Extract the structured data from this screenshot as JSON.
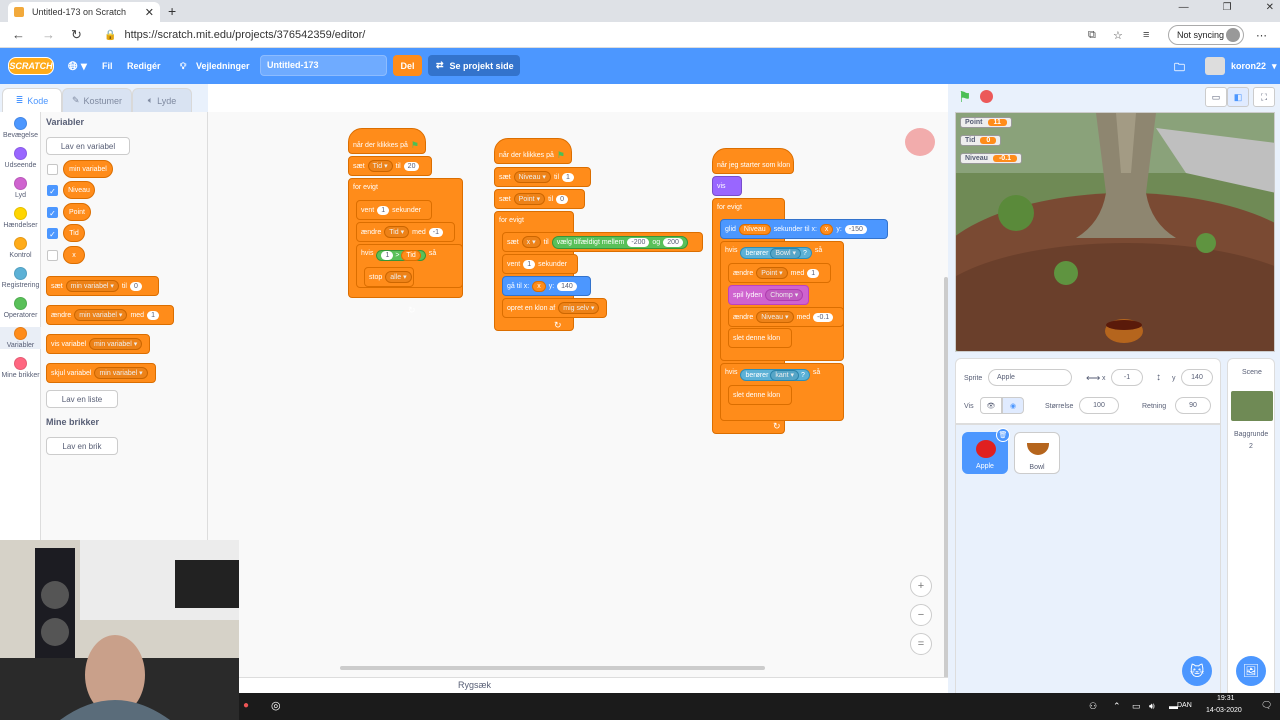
{
  "browser": {
    "tab_title": "Untitled-173 on Scratch",
    "url": "https://scratch.mit.edu/projects/376542359/editor/",
    "sync_label": "Not syncing"
  },
  "menu": {
    "logo": "SCRATCH",
    "file": "Fil",
    "edit": "Redigér",
    "tutorials": "Vejledninger",
    "project_title": "Untitled-173",
    "share": "Del",
    "see_project": "Se projekt side",
    "username": "koron22"
  },
  "tabs": {
    "code": "Kode",
    "costumes": "Kostumer",
    "sounds": "Lyde"
  },
  "categories": [
    {
      "label": "Bevægelse",
      "color": "#4c97ff"
    },
    {
      "label": "Udseende",
      "color": "#9966ff"
    },
    {
      "label": "Lyd",
      "color": "#cf63cf"
    },
    {
      "label": "Hændelser",
      "color": "#ffd500"
    },
    {
      "label": "Kontrol",
      "color": "#ffab19"
    },
    {
      "label": "Registrering",
      "color": "#5cb1d6"
    },
    {
      "label": "Operatorer",
      "color": "#59c059"
    },
    {
      "label": "Variabler",
      "color": "#ff8c1a"
    },
    {
      "label": "Mine brikker",
      "color": "#ff6680"
    }
  ],
  "palette": {
    "heading_variables": "Variabler",
    "make_variable": "Lav en variabel",
    "variables": [
      "min variabel",
      "Niveau",
      "Point",
      "Tid",
      "x"
    ],
    "block_set": "sæt",
    "block_set_var": "min variabel",
    "block_to": "til",
    "block_set_val": "0",
    "block_change": "ændre",
    "block_change_var": "min variabel",
    "block_by": "med",
    "block_change_val": "1",
    "block_show_var": "vis variabel",
    "block_show_var_name": "min variabel",
    "block_hide_var": "skjul variabel",
    "block_hide_var_name": "min variabel",
    "make_list": "Lav en liste",
    "heading_my_blocks": "Mine brikker",
    "make_block": "Lav en brik"
  },
  "script1": {
    "hat": "når der klikkes på",
    "set": "sæt",
    "var": "Tid",
    "to": "til",
    "val": "20",
    "forever": "for evigt",
    "wait": "vent",
    "wait_val": "1",
    "seconds": "sekunder",
    "change": "ændre",
    "change_var": "Tid",
    "by": "med",
    "change_val": "-1",
    "if": "hvis",
    "cmp_left": "1",
    "cmp_op": ">",
    "cmp_right": "Tid",
    "then": "så",
    "stop": "stop",
    "stop_opt": "alle"
  },
  "script2": {
    "hat": "når der klikkes på",
    "set1": "sæt",
    "set1_var": "Niveau",
    "to": "til",
    "set1_val": "1",
    "set2": "sæt",
    "set2_var": "Point",
    "set2_val": "0",
    "forever": "for evigt",
    "set3": "sæt",
    "set3_var": "x",
    "random": "vælg tilfældigt mellem",
    "rand_from": "-200",
    "and": "og",
    "rand_to": "200",
    "wait": "vent",
    "wait_val": "1",
    "seconds": "sekunder",
    "goto": "gå til x:",
    "goto_x": "x",
    "y": "y:",
    "goto_y": "140",
    "clone": "opret en klon af",
    "clone_of": "mig selv"
  },
  "script3": {
    "hat": "når jeg starter som klon",
    "show": "vis",
    "forever": "for evigt",
    "glide": "glid",
    "glide_var": "Niveau",
    "glide_secs": "sekunder til x:",
    "glide_x": "x",
    "y": "y:",
    "glide_y": "-150",
    "if1": "hvis",
    "touching": "berører",
    "touch1": "Bowl",
    "q": "?",
    "then": "så",
    "change": "ændre",
    "change_var": "Point",
    "by": "med",
    "change_val": "1",
    "sound": "spil lyden",
    "sound_name": "Chomp",
    "change2": "ændre",
    "change2_var": "Niveau",
    "change2_val": "-0.1",
    "delete": "slet denne klon",
    "if2": "hvis",
    "touch2": "kant",
    "delete2": "slet denne klon"
  },
  "backpack": "Rygsæk",
  "monitors": [
    {
      "label": "Point",
      "value": "11"
    },
    {
      "label": "Tid",
      "value": "0"
    },
    {
      "label": "Niveau",
      "value": "-0.1"
    }
  ],
  "sprite_info": {
    "sprite_label": "Sprite",
    "sprite_name": "Apple",
    "x_label": "x",
    "x": "-1",
    "y_label": "y",
    "y": "140",
    "show_label": "Vis",
    "size_label": "Størrelse",
    "size": "100",
    "direction_label": "Retning",
    "direction": "90"
  },
  "sprites": [
    {
      "name": "Apple"
    },
    {
      "name": "Bowl"
    }
  ],
  "stage_pane": {
    "label": "Scene",
    "backdrops_label": "Baggrunde",
    "backdrops_count": "2"
  },
  "taskbar": {
    "lang": "DAN",
    "time": "19:31",
    "date": "14-03-2020"
  }
}
